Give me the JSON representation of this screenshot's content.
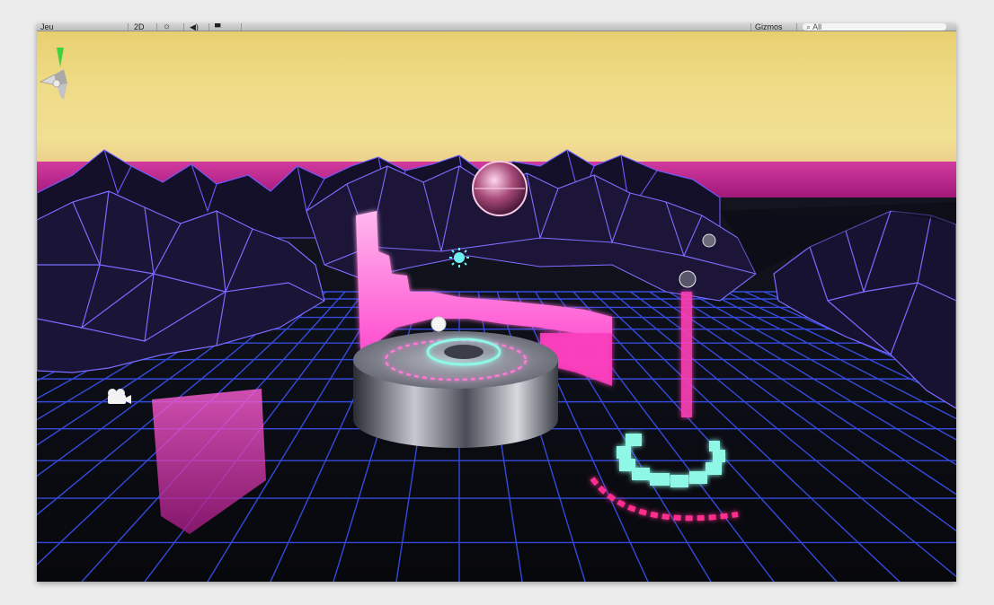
{
  "toolbar": {
    "draw_mode_label": "Jeu",
    "mode_2d_label": "2D",
    "light_icon_glyph": "☼",
    "audio_icon_glyph": "◀)",
    "effects_icon_glyph": "▀",
    "gizmos_label": "Gizmos",
    "search_value": "All",
    "search_icon_glyph": "⌕"
  },
  "scene": {
    "sky_color": "#efdc88",
    "horizon_color": "#c12a90",
    "grid_color": "#3c55ff",
    "neon_pink": "#ff4fd0",
    "neon_cyan": "#8ff7e6",
    "camera_icon": "camera-icon",
    "light_icon": "sun-light-icon"
  },
  "gizmo": {
    "axis_up_color": "#3fd43f",
    "axis_icon": "orientation-gizmo-icon"
  }
}
